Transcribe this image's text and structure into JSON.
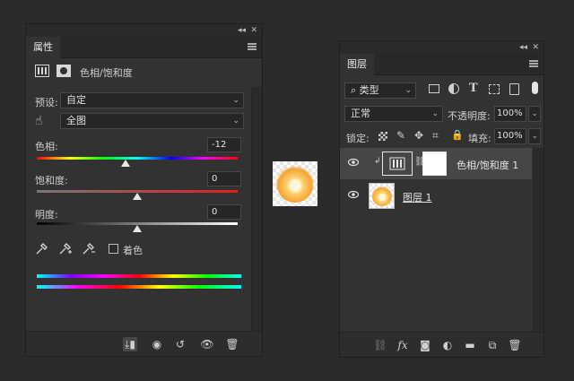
{
  "properties": {
    "tab_title": "属性",
    "adjustment_title": "色相/饱和度",
    "preset_label": "预设:",
    "preset_value": "自定",
    "channel_value": "全图",
    "hue_label": "色相:",
    "hue_value": "-12",
    "saturation_label": "饱和度:",
    "saturation_value": "0",
    "lightness_label": "明度:",
    "lightness_value": "0",
    "colorize_label": "着色",
    "hue_level": 0.47,
    "saturation_level": 0.5,
    "lightness_level": 0.5
  },
  "layers": {
    "tab_title": "图层",
    "filter_kind": "类型",
    "blend_mode": "正常",
    "opacity_label": "不透明度:",
    "opacity_value": "100%",
    "lock_label": "锁定:",
    "fill_label": "填充:",
    "fill_value": "100%",
    "items": [
      {
        "name": "色相/饱和度 1",
        "selected": true
      },
      {
        "name": "图层 1",
        "selected": false
      }
    ]
  },
  "colors": {
    "panel_bg": "#323232",
    "background": "#2b2b2b",
    "selected_row": "#464646"
  }
}
